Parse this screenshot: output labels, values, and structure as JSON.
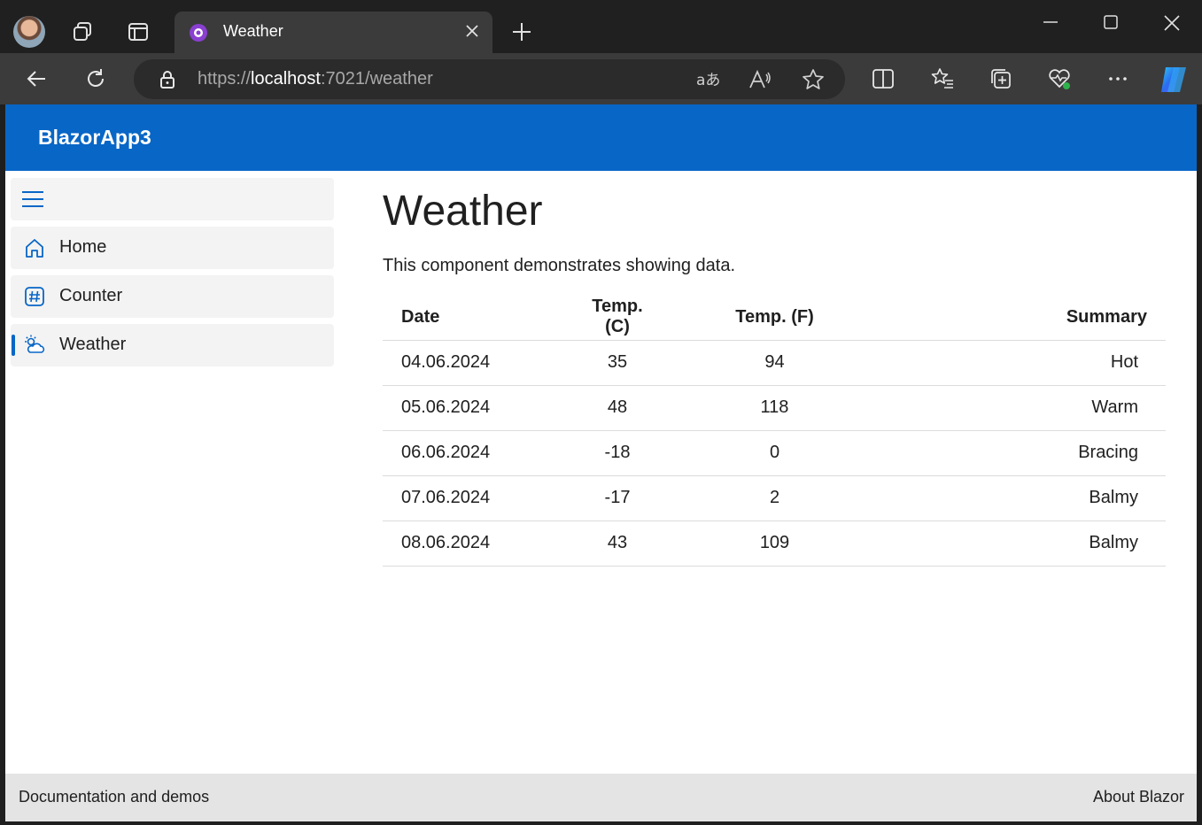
{
  "browser": {
    "tab_title": "Weather",
    "url_scheme": "https://",
    "url_host": "localhost",
    "url_path": ":7021/weather"
  },
  "app": {
    "brand": "BlazorApp3",
    "nav": [
      {
        "label": "Home",
        "icon": "home-icon",
        "active": false
      },
      {
        "label": "Counter",
        "icon": "hash-icon",
        "active": false
      },
      {
        "label": "Weather",
        "icon": "weather-icon",
        "active": true
      }
    ]
  },
  "main": {
    "title": "Weather",
    "description": "This component demonstrates showing data.",
    "table": {
      "headers": [
        "Date",
        "Temp. (C)",
        "Temp. (F)",
        "Summary"
      ],
      "rows": [
        [
          "04.06.2024",
          "35",
          "94",
          "Hot"
        ],
        [
          "05.06.2024",
          "48",
          "118",
          "Warm"
        ],
        [
          "06.06.2024",
          "-18",
          "0",
          "Bracing"
        ],
        [
          "07.06.2024",
          "-17",
          "2",
          "Balmy"
        ],
        [
          "08.06.2024",
          "43",
          "109",
          "Balmy"
        ]
      ]
    }
  },
  "footer": {
    "left": "Documentation and demos",
    "right": "About Blazor"
  },
  "colors": {
    "accent": "#0866c6",
    "browser_dark": "#202020",
    "toolbar": "#3b3b3b"
  }
}
